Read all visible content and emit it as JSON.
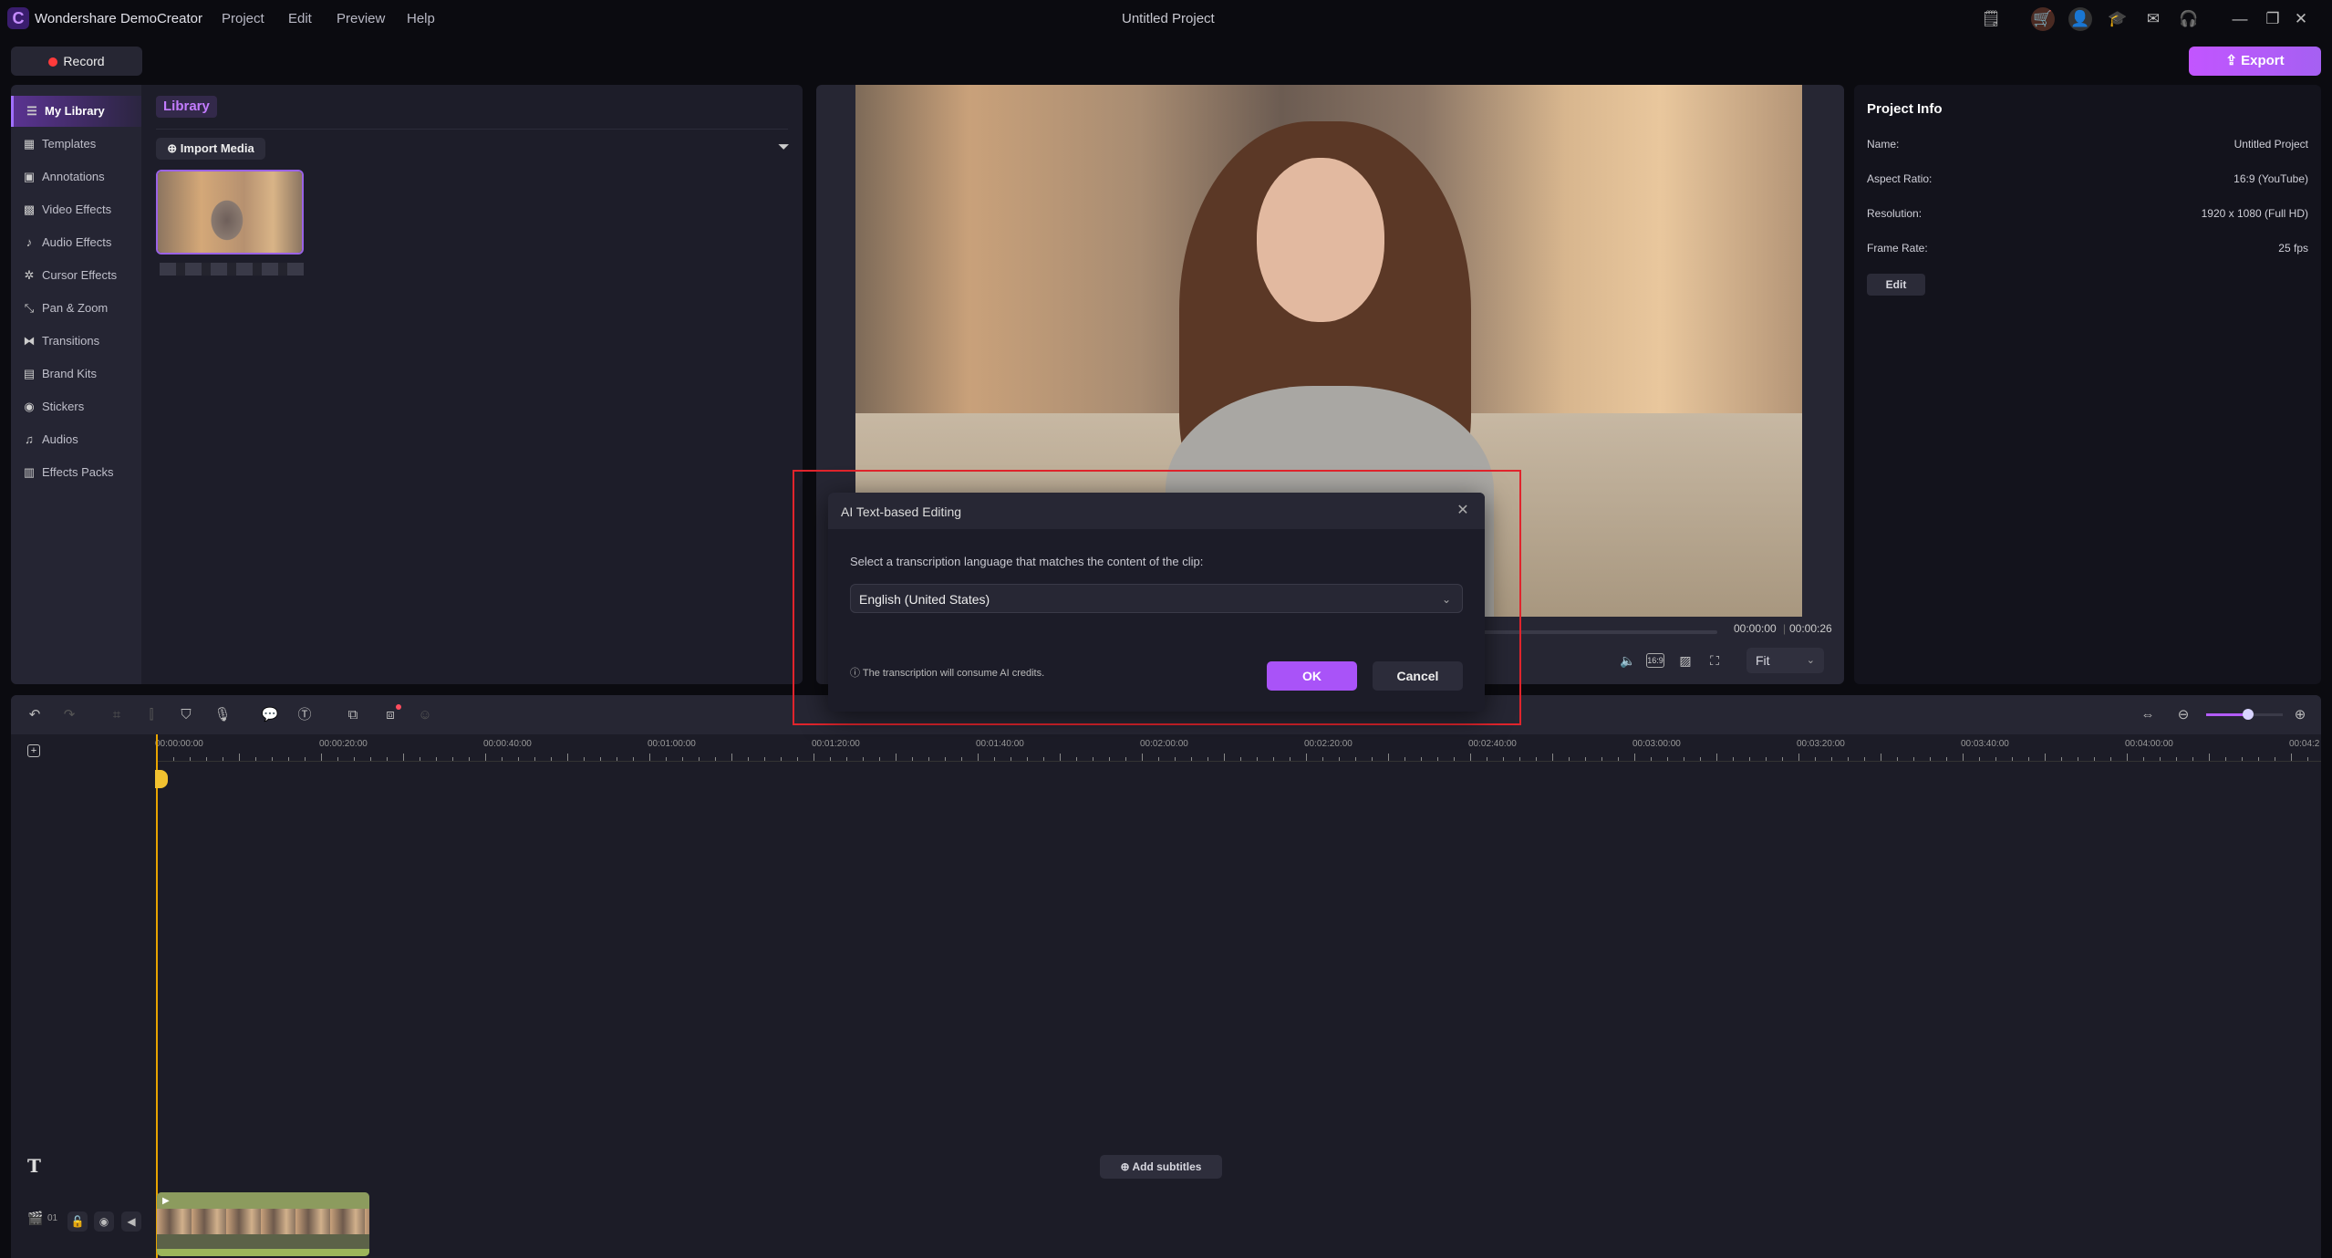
{
  "app": {
    "name": "Wondershare DemoCreator",
    "project_title": "Untitled Project",
    "menu": [
      "Project",
      "Edit",
      "Preview",
      "Help"
    ],
    "title_icons": [
      "notes-icon",
      "cart-icon",
      "account-icon",
      "tutorial-icon",
      "mail-icon",
      "support-icon",
      "minimize-icon",
      "restore-icon",
      "close-icon"
    ]
  },
  "toolbar": {
    "record_label": "Record",
    "export_label": "Export",
    "accent": "#b35cf9"
  },
  "sidebar": {
    "items": [
      {
        "label": "My Library",
        "icon": "layers-icon",
        "active": true
      },
      {
        "label": "Templates",
        "icon": "template-icon"
      },
      {
        "label": "Annotations",
        "icon": "annotation-icon"
      },
      {
        "label": "Video Effects",
        "icon": "video-effects-icon"
      },
      {
        "label": "Audio Effects",
        "icon": "audio-effects-icon"
      },
      {
        "label": "Cursor Effects",
        "icon": "cursor-icon"
      },
      {
        "label": "Pan & Zoom",
        "icon": "pan-zoom-icon"
      },
      {
        "label": "Transitions",
        "icon": "transition-icon"
      },
      {
        "label": "Brand Kits",
        "icon": "brand-icon"
      },
      {
        "label": "Stickers",
        "icon": "sticker-icon"
      },
      {
        "label": "Audios",
        "icon": "music-icon"
      },
      {
        "label": "Effects Packs",
        "icon": "pack-icon"
      }
    ]
  },
  "library": {
    "tab": "Library",
    "import_label": "Import Media"
  },
  "preview": {
    "current_time": "00:00:00",
    "total_time": "00:00:26",
    "zoom_select": "Fit",
    "aspect_badge": "16:9"
  },
  "project_info": {
    "title": "Project Info",
    "rows": [
      {
        "label": "Name:",
        "value": "Untitled Project"
      },
      {
        "label": "Aspect Ratio:",
        "value": "16:9 (YouTube)"
      },
      {
        "label": "Resolution:",
        "value": "1920 x 1080 (Full HD)"
      },
      {
        "label": "Frame Rate:",
        "value": "25 fps"
      }
    ],
    "edit_label": "Edit"
  },
  "timeline": {
    "ruler_labels": [
      "00:00:00:00",
      "00:00:20:00",
      "00:00:40:00",
      "00:01:00:00",
      "00:01:20:00",
      "00:01:40:00",
      "00:02:00:00",
      "00:02:20:00",
      "00:02:40:00",
      "00:03:00:00",
      "00:03:20:00",
      "00:03:40:00",
      "00:04:00:00",
      "00:04:2"
    ],
    "add_subtitles": "Add subtitles",
    "track_number": "01",
    "zoom_level": 0.55
  },
  "dialog": {
    "title": "AI Text-based Editing",
    "prompt": "Select a transcription language that matches the content of the clip:",
    "language": "English (United States)",
    "note": "The transcription will consume AI credits.",
    "ok": "OK",
    "cancel": "Cancel"
  }
}
